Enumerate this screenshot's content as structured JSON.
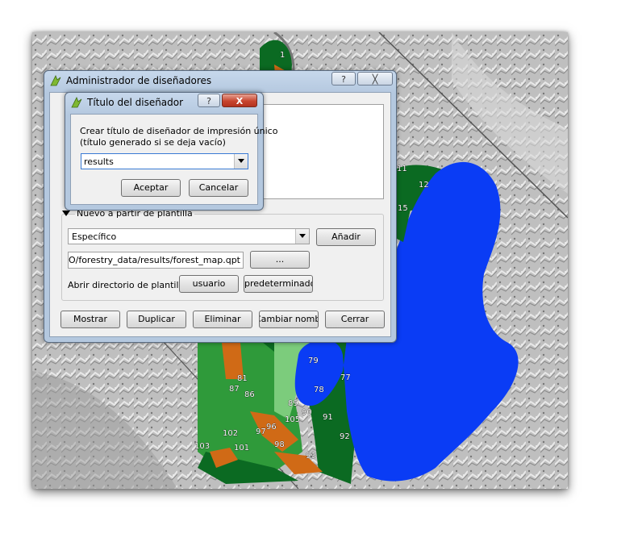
{
  "designer_manager": {
    "title": "Administrador de diseñadores",
    "help_button": "?",
    "close_button": "╳",
    "template_section_label": "Nuevo a partir de plantilla",
    "template_combo_value": "Específico",
    "add_button": "Añadir",
    "template_path": "ARDO/forestry_data/results/forest_map.qpt",
    "browse_button": "...",
    "open_dir_label": "Abrir directorio de plantillas",
    "user_button": "usuario",
    "default_button": "predeterminado",
    "show_button": "Mostrar",
    "duplicate_button": "Duplicar",
    "delete_button": "Eliminar",
    "rename_button": "Cambiar nombre",
    "close_action_button": "Cerrar"
  },
  "title_dialog": {
    "title": "Título del diseñador",
    "help_button": "?",
    "close_button": "X",
    "prompt_line1": "Crear título de diseñador de impresión único",
    "prompt_line2": "(título generado si se deja vacío)",
    "input_value": "results",
    "accept_button": "Aceptar",
    "cancel_button": "Cancelar"
  },
  "map": {
    "labels": [
      "1",
      "11",
      "12",
      "15",
      "79",
      "77",
      "81",
      "87",
      "86",
      "78",
      "89",
      "90",
      "91",
      "105",
      "96",
      "97",
      "102",
      "98",
      "92",
      "101",
      "103",
      "93"
    ],
    "colors": {
      "lake": "#0a3cf5",
      "forest_dark": "#0b6a22",
      "forest_mid": "#2f9a3a",
      "forest_light": "#7ccc7c",
      "clearcut": "#d06a16",
      "hillshade": "#b8b8b8"
    }
  }
}
